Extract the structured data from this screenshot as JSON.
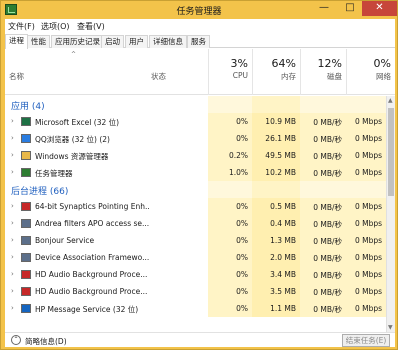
{
  "window": {
    "title": "任务管理器",
    "minimize": "—",
    "maximize": "□",
    "close": "✕"
  },
  "menu": [
    "文件(F)",
    "选项(O)",
    "查看(V)"
  ],
  "tabs": [
    "进程",
    "性能",
    "应用历史记录",
    "启动",
    "用户",
    "详细信息",
    "服务"
  ],
  "header": {
    "name": "名称",
    "status": "状态",
    "cpu_pct": "3%",
    "cpu": "CPU",
    "mem_pct": "64%",
    "mem": "内存",
    "disk_pct": "12%",
    "disk": "磁盘",
    "net_pct": "0%",
    "net": "网络"
  },
  "groups": {
    "apps": "应用 (4)",
    "background": "后台进程 (66)"
  },
  "apps": [
    {
      "name": "Microsoft Excel (32 位)",
      "cpu": "0%",
      "mem": "10.9 MB",
      "disk": "0 MB/秒",
      "net": "0 Mbps",
      "icon": "excel-icon",
      "color": "#1e7145"
    },
    {
      "name": "QQ浏览器 (32 位) (2)",
      "cpu": "0%",
      "mem": "26.1 MB",
      "disk": "0 MB/秒",
      "net": "0 Mbps",
      "icon": "qq-browser-icon",
      "color": "#2a7de1"
    },
    {
      "name": "Windows 资源管理器",
      "cpu": "0.2%",
      "mem": "49.5 MB",
      "disk": "0 MB/秒",
      "net": "0 Mbps",
      "icon": "folder-icon",
      "color": "#e8b84a"
    },
    {
      "name": "任务管理器",
      "cpu": "1.0%",
      "mem": "10.2 MB",
      "disk": "0 MB/秒",
      "net": "0 Mbps",
      "icon": "task-manager-icon",
      "color": "#2e7d32"
    }
  ],
  "background": [
    {
      "name": "64-bit Synaptics Pointing Enh...",
      "cpu": "0%",
      "mem": "0.5 MB",
      "disk": "0 MB/秒",
      "net": "0 Mbps",
      "icon": "synaptics-icon",
      "color": "#c62828"
    },
    {
      "name": "Andrea filters APO access se...",
      "cpu": "0%",
      "mem": "0.4 MB",
      "disk": "0 MB/秒",
      "net": "0 Mbps",
      "icon": "service-icon",
      "color": "#5c6f8a"
    },
    {
      "name": "Bonjour Service",
      "cpu": "0%",
      "mem": "1.3 MB",
      "disk": "0 MB/秒",
      "net": "0 Mbps",
      "icon": "service-icon",
      "color": "#5c6f8a"
    },
    {
      "name": "Device Association Framewo...",
      "cpu": "0%",
      "mem": "2.0 MB",
      "disk": "0 MB/秒",
      "net": "0 Mbps",
      "icon": "service-icon",
      "color": "#5c6f8a"
    },
    {
      "name": "HD Audio Background Proce...",
      "cpu": "0%",
      "mem": "3.4 MB",
      "disk": "0 MB/秒",
      "net": "0 Mbps",
      "icon": "audio-icon",
      "color": "#c62828"
    },
    {
      "name": "HD Audio Background Proce...",
      "cpu": "0%",
      "mem": "3.5 MB",
      "disk": "0 MB/秒",
      "net": "0 Mbps",
      "icon": "audio-icon",
      "color": "#c62828"
    },
    {
      "name": "HP Message Service (32 位)",
      "cpu": "0%",
      "mem": "1.1 MB",
      "disk": "0 MB/秒",
      "net": "0 Mbps",
      "icon": "hp-icon",
      "color": "#1565c0"
    }
  ],
  "footer": {
    "fewer_details": "简略信息(D)",
    "end_task": "结束任务(E)",
    "fewer_icon": "⌃"
  }
}
